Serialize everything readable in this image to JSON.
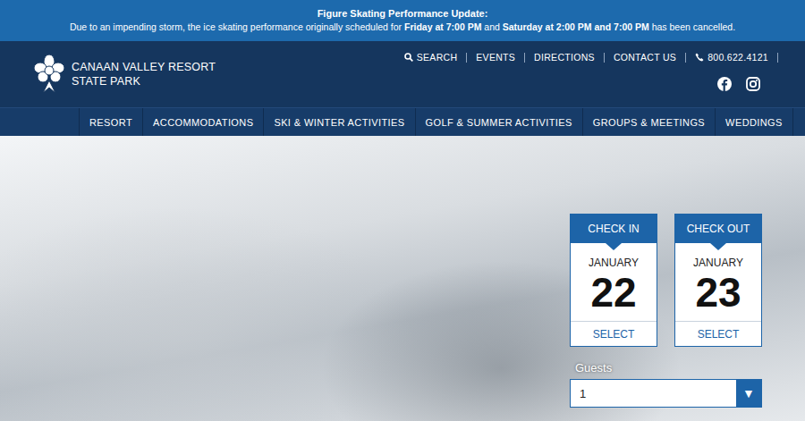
{
  "alert": {
    "title": "Figure Skating Performance Update:",
    "message": [
      {
        "text": "Due to an impending storm, the ice skating performance originally scheduled for ",
        "bold": false
      },
      {
        "text": "Friday at 7:00 PM",
        "bold": true
      },
      {
        "text": " and ",
        "bold": false
      },
      {
        "text": "Saturday at 2:00 PM and 7:00 PM",
        "bold": true
      },
      {
        "text": " has been cancelled.",
        "bold": false
      }
    ]
  },
  "logo": {
    "lines": [
      "CANAAN VALLEY RESORT",
      "STATE PARK"
    ]
  },
  "top_links": [
    {
      "label": "SEARCH",
      "kind": "search"
    },
    {
      "label": "EVENTS",
      "kind": "plain"
    },
    {
      "label": "DIRECTIONS",
      "kind": "plain"
    },
    {
      "label": "CONTACT US",
      "kind": "plain"
    },
    {
      "label": "800.622.4121",
      "kind": "phone"
    }
  ],
  "social": [
    {
      "name": "facebook"
    },
    {
      "name": "instagram"
    }
  ],
  "nav": [
    {
      "label": "RESORT"
    },
    {
      "label": "ACCOMMODATIONS"
    },
    {
      "label": "SKI & WINTER ACTIVITIES"
    },
    {
      "label": "GOLF & SUMMER ACTIVITIES"
    },
    {
      "label": "GROUPS & MEETINGS"
    },
    {
      "label": "WEDDINGS"
    }
  ],
  "booking": {
    "dates": [
      {
        "label": "CHECK IN",
        "month": "JANUARY",
        "day": "22",
        "action": "SELECT"
      },
      {
        "label": "CHECK OUT",
        "month": "JANUARY",
        "day": "23",
        "action": "SELECT"
      }
    ],
    "guests": {
      "label": "Guests",
      "value": "1",
      "arrow": "▼"
    }
  }
}
